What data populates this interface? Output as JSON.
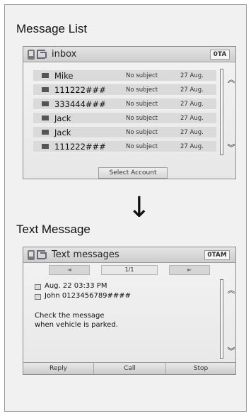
{
  "sections": {
    "message_list_title": "Message List",
    "text_message_title": "Text Message"
  },
  "inbox_screen": {
    "title": "inbox",
    "status": "0TA",
    "rows": [
      {
        "sender": "Mike",
        "subject": "No subject",
        "date": "27 Aug."
      },
      {
        "sender": "111222###",
        "subject": "No subject",
        "date": "27 Aug."
      },
      {
        "sender": "333444###",
        "subject": "No subject",
        "date": "27 Aug."
      },
      {
        "sender": "Jack",
        "subject": "No subject",
        "date": "27 Aug."
      },
      {
        "sender": "Jack",
        "subject": "No subject",
        "date": "27 Aug."
      },
      {
        "sender": "111222###",
        "subject": "No subject",
        "date": "27 Aug."
      }
    ],
    "select_account_label": "Select Account",
    "scroll_up": "︽",
    "scroll_down": "︾"
  },
  "text_screen": {
    "title": "Text messages",
    "status": "0TAM",
    "page_indicator": "1/1",
    "prev_label": "◄",
    "next_label": "►",
    "datetime": "Aug. 22 03:33 PM",
    "sender": "John 0123456789####",
    "body_line1": "Check the message",
    "body_line2": "when vehicle is parked.",
    "softkeys": {
      "reply": "Reply",
      "call": "Call",
      "stop": "Stop"
    },
    "scroll_up": "︽",
    "scroll_down": "︾"
  },
  "icons": {
    "arrow": "down-arrow-icon",
    "phone": "phone-icon",
    "back": "back-icon",
    "envelope": "envelope-icon",
    "calendar": "calendar-icon",
    "person": "person-icon"
  }
}
